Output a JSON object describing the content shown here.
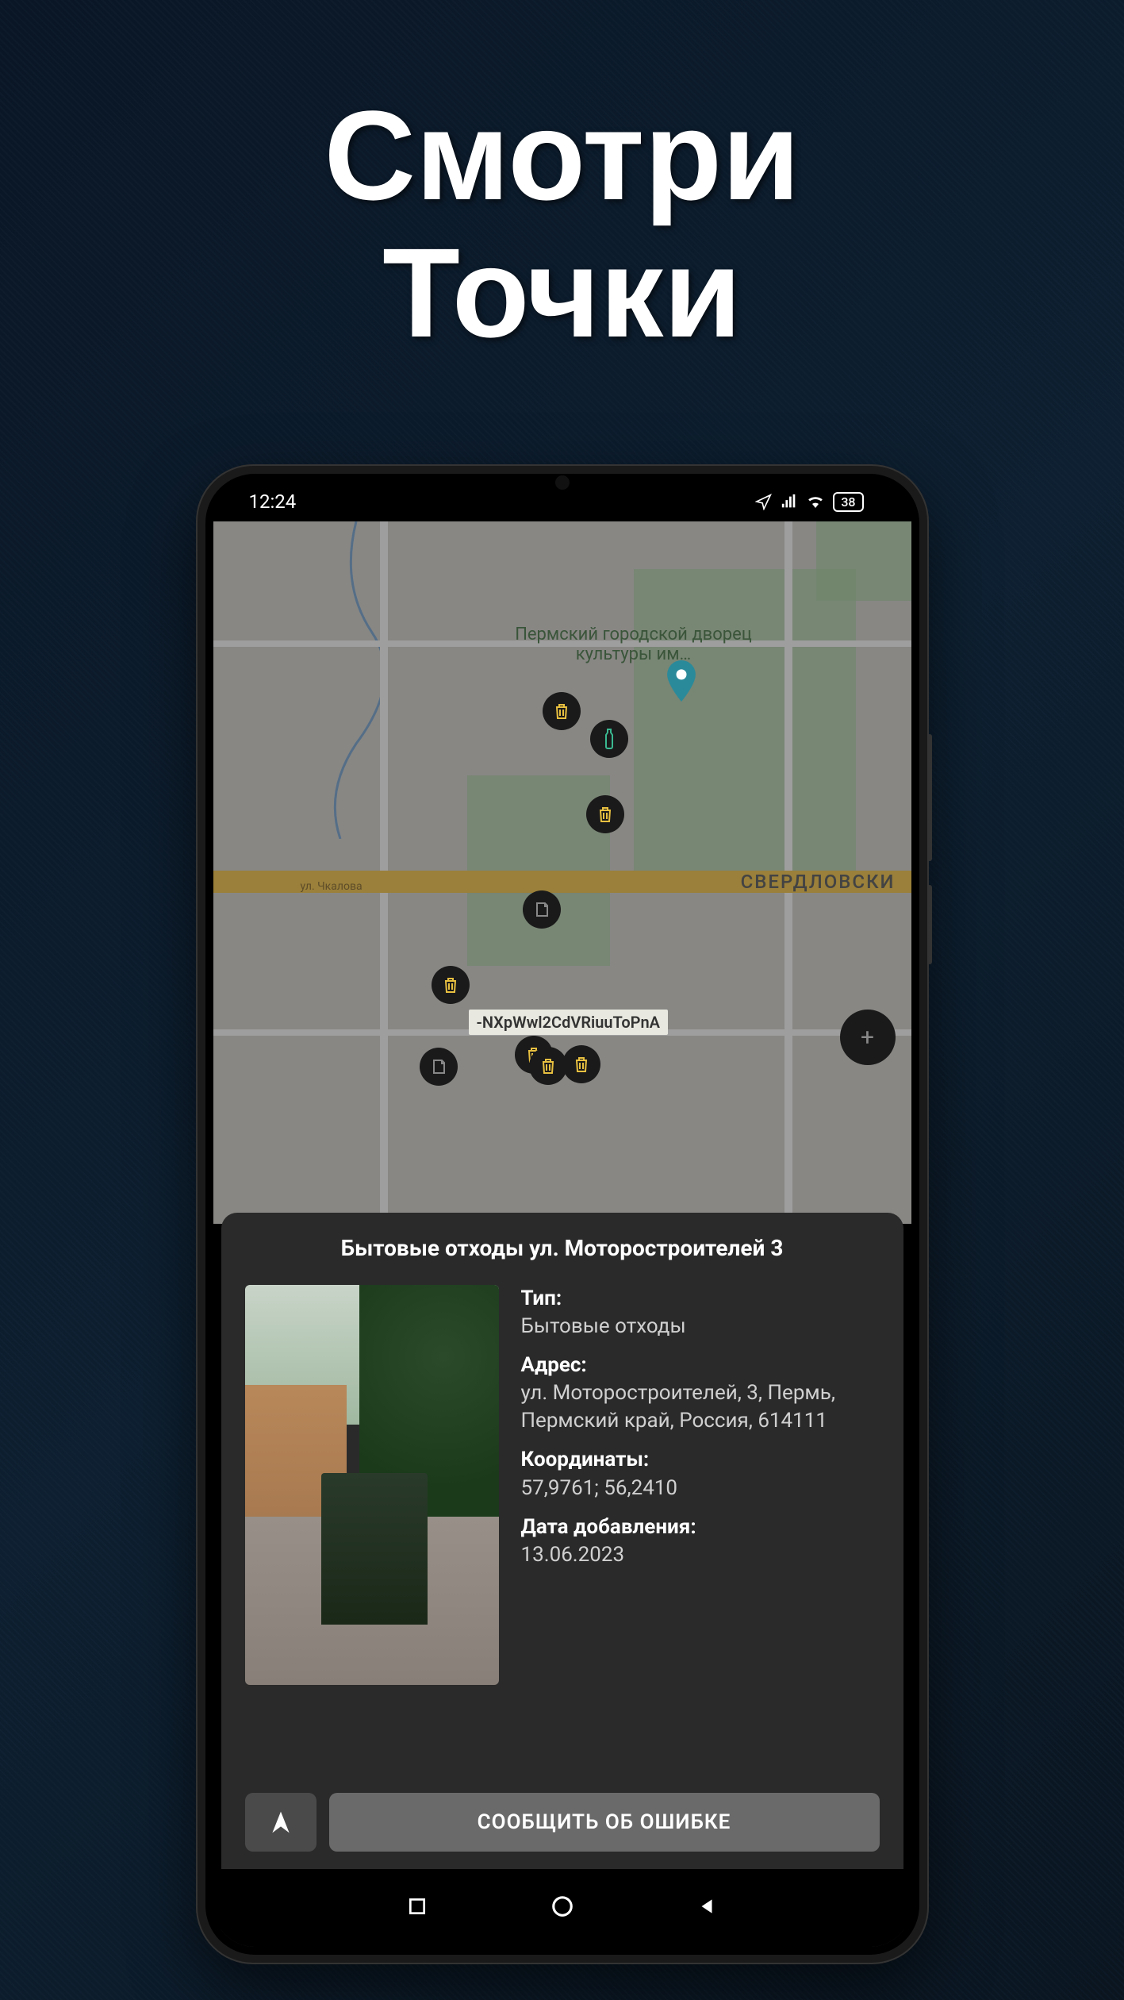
{
  "promo": {
    "line1": "Смотри",
    "line2": "Точки"
  },
  "status": {
    "time": "12:24",
    "battery": "38"
  },
  "map": {
    "poi_culture": "Пермский городской дворец культуры им…",
    "city": "СВЕРДЛОВСКИ",
    "street": "ул. Чкалова",
    "marker_code": "-NXpWwl2CdVRiuuToPnA"
  },
  "sheet": {
    "title": "Бытовые отходы ул. Моторостроителей 3",
    "labels": {
      "type": "Тип:",
      "address": "Адрес:",
      "coords": "Координаты:",
      "date": "Дата добавления:"
    },
    "type": "Бытовые отходы",
    "address": "ул. Моторостроителей, 3, Пермь, Пермский край, Россия, 614111",
    "coords": "57,9761; 56,2410",
    "date": "13.06.2023",
    "report_button": "СООБЩИТЬ ОБ ОШИБКЕ"
  },
  "icons": {
    "trash": "trash-icon",
    "bottle": "bottle-icon",
    "paper": "paper-icon",
    "pin": "location-pin-icon",
    "nav_arrow": "nav-arrow-icon",
    "plus": "plus-icon"
  }
}
